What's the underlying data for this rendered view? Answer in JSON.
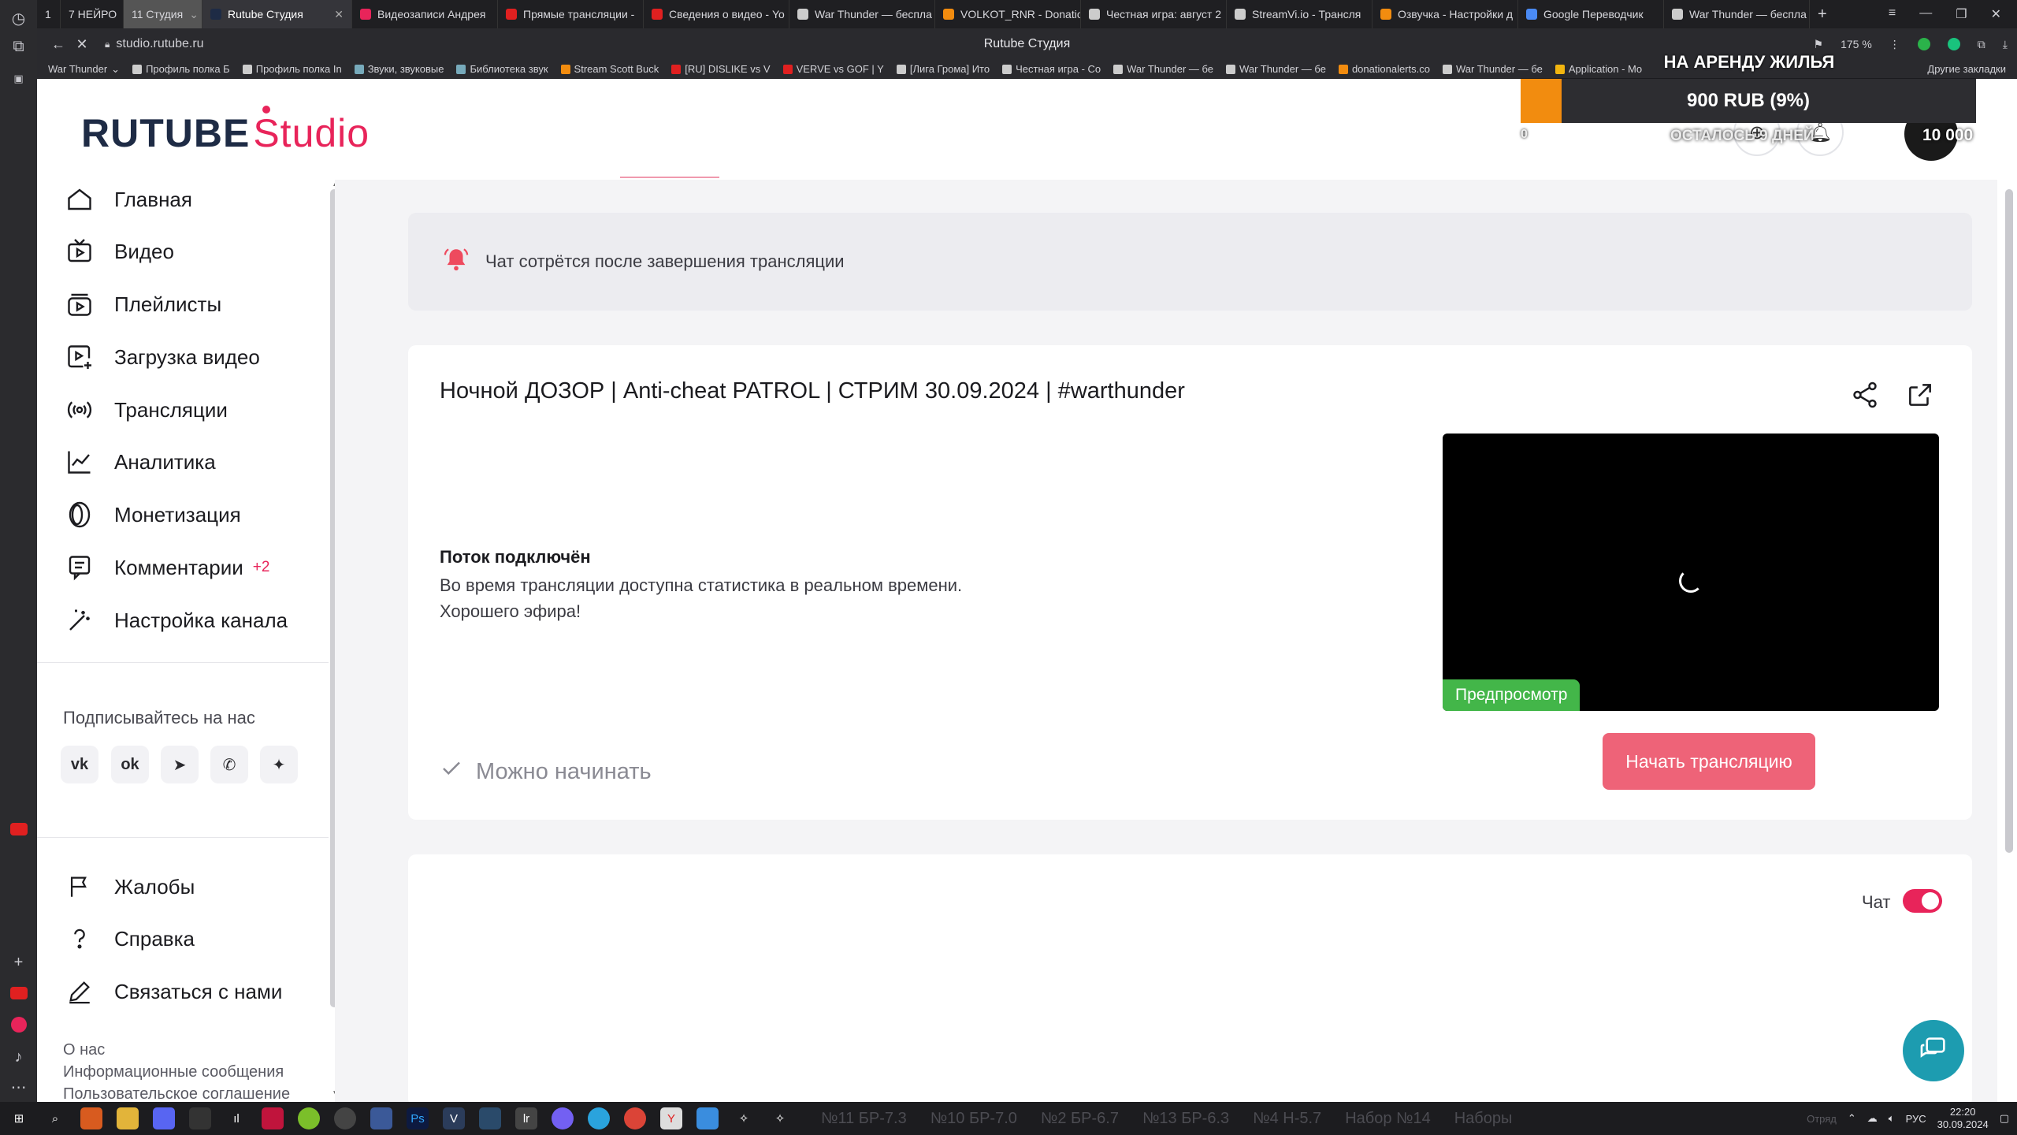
{
  "browser": {
    "tabs": [
      {
        "label": "1",
        "color": "#4a4a4f"
      },
      {
        "label": "7 НЕЙРО",
        "color": "#4a4a4f"
      },
      {
        "label": "11 Студия",
        "color": "#888888"
      },
      {
        "label": "Rutube Студия",
        "color": "#1e2b45",
        "active": true
      },
      {
        "label": "Видеозаписи Андрея",
        "color": "#e8245a"
      },
      {
        "label": "Прямые трансляции -",
        "color": "#e02020"
      },
      {
        "label": "Сведения о видео - Yo",
        "color": "#e02020"
      },
      {
        "label": "War Thunder — беспла",
        "color": "#cccccc"
      },
      {
        "label": "VOLKOT_RNR - Donatio",
        "color": "#f28c0f"
      },
      {
        "label": "Честная игра: август 2",
        "color": "#cccccc"
      },
      {
        "label": "StreamVi.io - Трансля",
        "color": "#cccccc"
      },
      {
        "label": "Озвучка - Настройки д",
        "color": "#f28c0f"
      },
      {
        "label": "Google Переводчик",
        "color": "#4a8af4"
      },
      {
        "label": "War Thunder — беспла",
        "color": "#cccccc"
      }
    ],
    "url": "studio.rutube.ru",
    "window_title": "Rutube Студия",
    "zoom": "175 %",
    "bookmarks": [
      "War Thunder",
      "Профиль полка Б",
      "Профиль полка In",
      "Звуки, звуковые",
      "Библиотека звук",
      "Stream Scott Buck",
      "[RU] DISLIKE vs V",
      "VERVE vs GOF | Y",
      "[Лига Грома] Ито",
      "Честная игра - Co",
      "War Thunder — бе",
      "War Thunder — бе",
      "donationalerts.co",
      "War Thunder — бе",
      "Application - Mo"
    ],
    "bookmarks_other": "Другие закладки"
  },
  "donation": {
    "title": "НА АРЕНДУ ЖИЛЬЯ",
    "amount": "900 RUB (9%)",
    "progress_fraction": 0.09,
    "days_left": "ОСТАЛОСЬ 9 ДНЕЙ",
    "start": "0",
    "goal": "10 000",
    "fill_color": "#f28c0f"
  },
  "logo": {
    "part1": "RUTUBE",
    "part2": "Studio"
  },
  "sidebar": {
    "items": [
      {
        "label": "Главная",
        "icon": "home-icon"
      },
      {
        "label": "Видео",
        "icon": "video-icon"
      },
      {
        "label": "Плейлисты",
        "icon": "playlist-icon"
      },
      {
        "label": "Загрузка видео",
        "icon": "upload-icon"
      },
      {
        "label": "Трансляции",
        "icon": "broadcast-icon"
      },
      {
        "label": "Аналитика",
        "icon": "analytics-icon"
      },
      {
        "label": "Монетизация",
        "icon": "coin-icon"
      },
      {
        "label": "Комментарии",
        "icon": "comments-icon",
        "badge": "+2"
      },
      {
        "label": "Настройка канала",
        "icon": "magic-wand-icon"
      }
    ],
    "follow_title": "Подписывайтесь на нас",
    "socials": [
      "vk-icon",
      "ok-icon",
      "telegram-icon",
      "viber-icon",
      "dzen-icon"
    ],
    "support_items": [
      {
        "label": "Жалобы",
        "icon": "flag-icon"
      },
      {
        "label": "Справка",
        "icon": "help-icon"
      },
      {
        "label": "Связаться с нами",
        "icon": "pencil-icon"
      }
    ],
    "footer_links": [
      "О нас",
      "Информационные сообщения",
      "Пользовательское соглашение"
    ]
  },
  "main": {
    "chat_notice": "Чат сотрётся после завершения трансляции",
    "stream": {
      "title": "Ночной ДОЗОР | Anti-cheat PATROL | СТРИМ 30.09.2024 | #warthunder",
      "status_title": "Поток подключён",
      "status_line1": "Во время трансляции доступна статистика в реальном времени.",
      "status_line2": "Хорошего эфира!",
      "preview_label": "Предпросмотр",
      "ready_text": "Можно начинать",
      "start_button": "Начать трансляцию"
    },
    "chat": {
      "toggle_label": "Чат",
      "enabled": true
    }
  },
  "taskbar": {
    "game_items": [
      "№11 БР-7.3",
      "№10 БР-7.0",
      "№2 БР-6.7",
      "№13 БР-6.3",
      "№4 Н-5.7",
      "Набор №14",
      "Наборы"
    ],
    "tray_label": "Отряд",
    "lang": "РУС",
    "time": "22:20",
    "date": "30.09.2024"
  },
  "colors": {
    "brand_pink": "#e8245a",
    "start_button": "#ee6378",
    "preview_green": "#43b649",
    "support_teal": "#1d9cb0"
  }
}
